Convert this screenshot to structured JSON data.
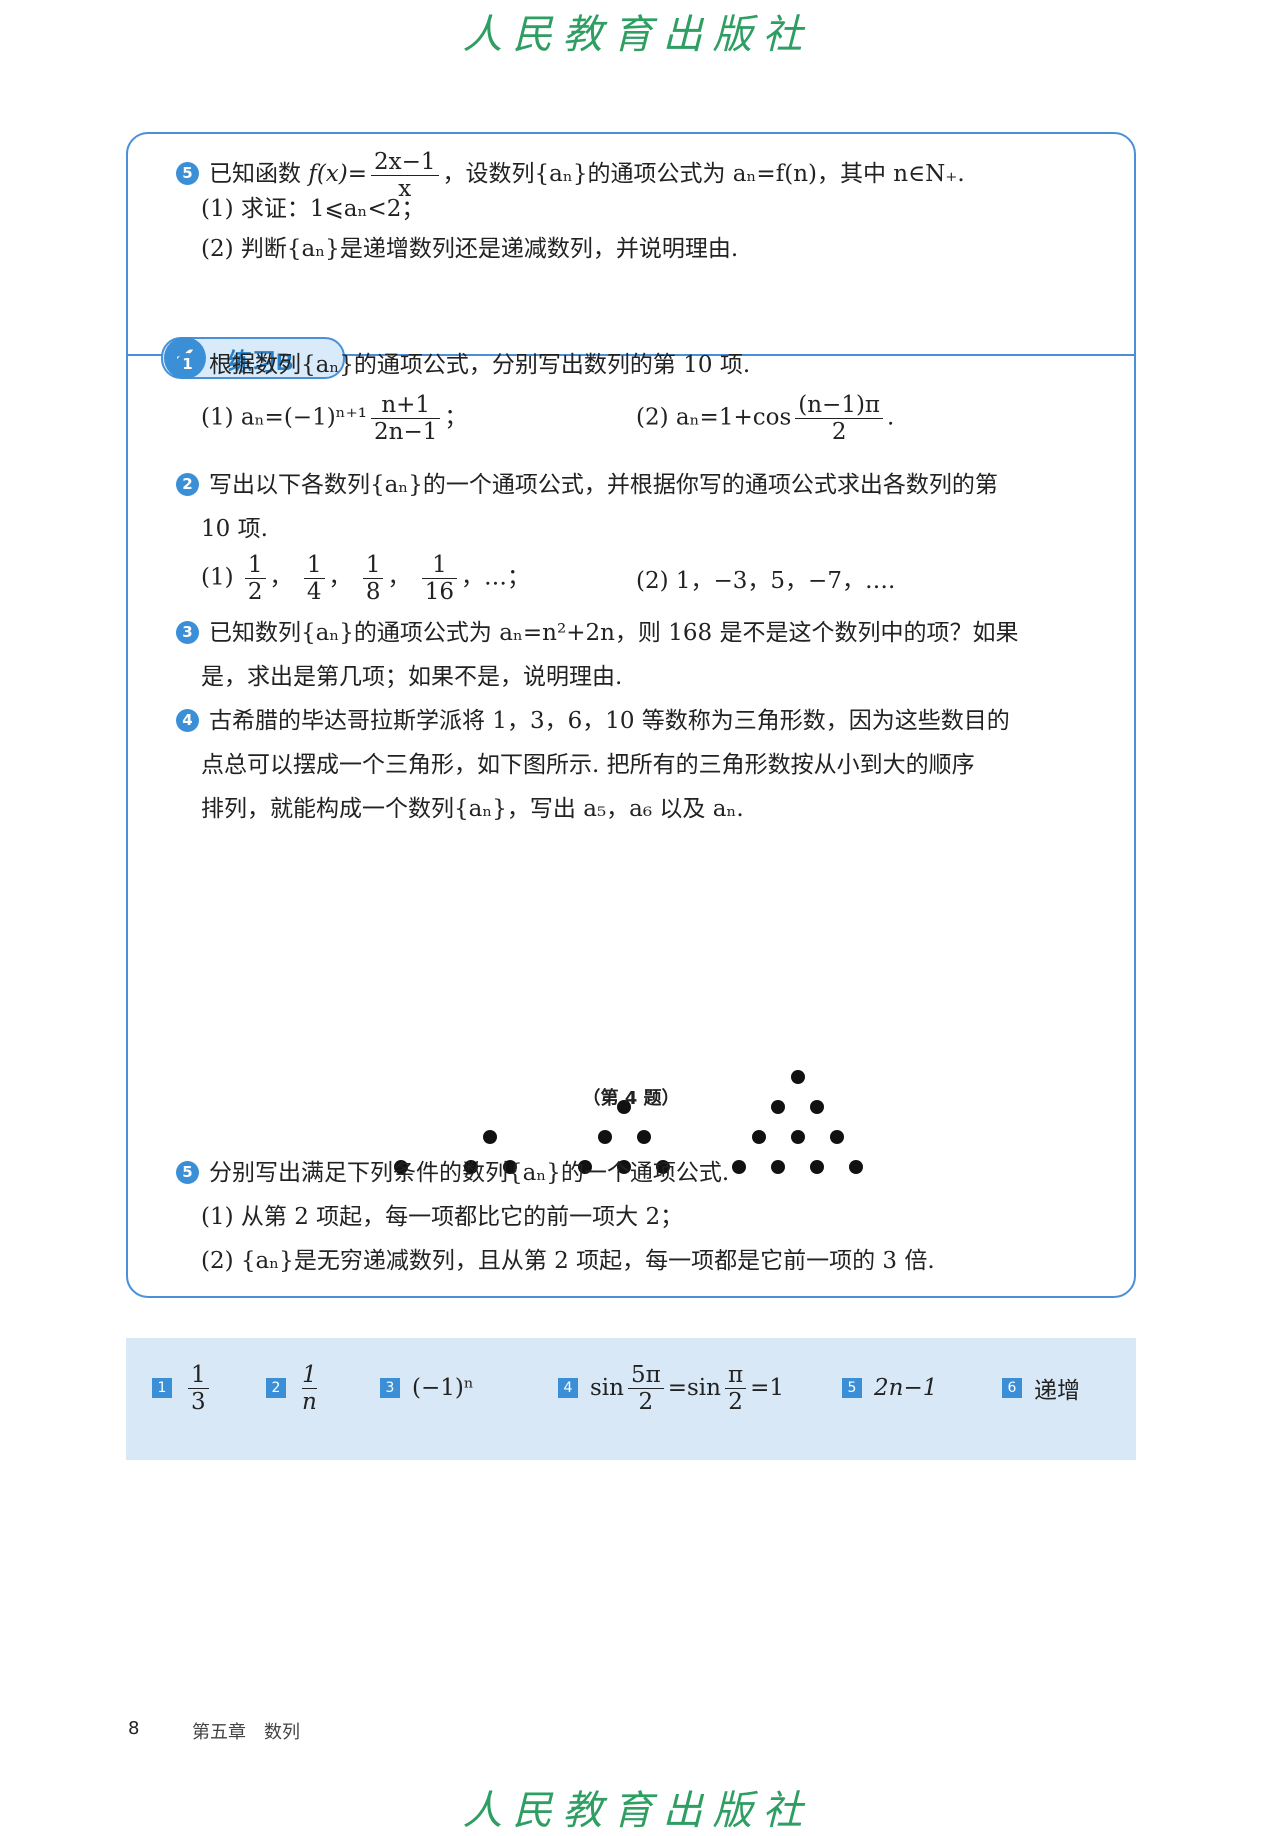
{
  "publisher": "人民教育出版社",
  "problem5_top": {
    "num": "5",
    "text_a": "已知函数 ",
    "fx": "f(x)=",
    "frac_num": "2x−1",
    "frac_den": "x",
    "text_b": "，设数列{aₙ}的通项公式为 aₙ=f(n)，其中 n∈N₊.",
    "part1": "(1) 求证：1⩽aₙ<2；",
    "part2": "(2) 判断{aₙ}是递增数列还是递减数列，并说明理由."
  },
  "section_title": "练习B",
  "q1": {
    "num": "1",
    "text": "根据数列{aₙ}的通项公式，分别写出数列的第 10 项.",
    "p1_lead": "(1) aₙ=(−1)ⁿ⁺¹",
    "p1_num": "n+1",
    "p1_den": "2n−1",
    "p1_tail": "；",
    "p2_lead": "(2) aₙ=1+cos",
    "p2_num": "(n−1)π",
    "p2_den": "2",
    "p2_tail": "."
  },
  "q2": {
    "num": "2",
    "text": "写出以下各数列{aₙ}的一个通项公式，并根据你写的通项公式求出各数列的第",
    "text2": "10 项.",
    "p1_lead": "(1)",
    "fracs": [
      {
        "num": "1",
        "den": "2"
      },
      {
        "num": "1",
        "den": "4"
      },
      {
        "num": "1",
        "den": "8"
      },
      {
        "num": "1",
        "den": "16"
      }
    ],
    "p1_tail": "，…；",
    "p2": "(2) 1，−3，5，−7，…."
  },
  "q3": {
    "num": "3",
    "text": "已知数列{aₙ}的通项公式为 aₙ=n²+2n，则 168 是不是这个数列中的项？如果",
    "text2": "是，求出是第几项；如果不是，说明理由."
  },
  "q4": {
    "num": "4",
    "text": "古希腊的毕达哥拉斯学派将 1，3，6，10 等数称为三角形数，因为这些数目的",
    "text2": "点总可以摆成一个三角形，如下图所示. 把所有的三角形数按从小到大的顺序",
    "text3": "排列，就能构成一个数列{aₙ}，写出 a₅，a₆ 以及 aₙ.",
    "caption": "（第 4 题）"
  },
  "q5": {
    "num": "5",
    "text": "分别写出满足下列条件的数列{aₙ}的一个通项公式.",
    "part1": "(1) 从第 2 项起，每一项都比它的前一项大 2；",
    "part2": "(2) {aₙ}是无穷递减数列，且从第 2 项起，每一项都是它前一项的 3 倍."
  },
  "answers": {
    "a1": {
      "n": "1",
      "num": "1",
      "den": "3"
    },
    "a2": {
      "n": "2",
      "num": "1",
      "den": "n"
    },
    "a3": {
      "n": "3",
      "text": "(−1)ⁿ"
    },
    "a4": {
      "n": "4",
      "lead": "sin",
      "num1": "5π",
      "den1": "2",
      "mid": "=sin",
      "num2": "π",
      "den2": "2",
      "tail": "=1"
    },
    "a5": {
      "n": "5",
      "text": "2n−1"
    },
    "a6": {
      "n": "6",
      "text": "递增"
    }
  },
  "footer": {
    "page_number": "8",
    "chapter": "第五章　数列"
  }
}
